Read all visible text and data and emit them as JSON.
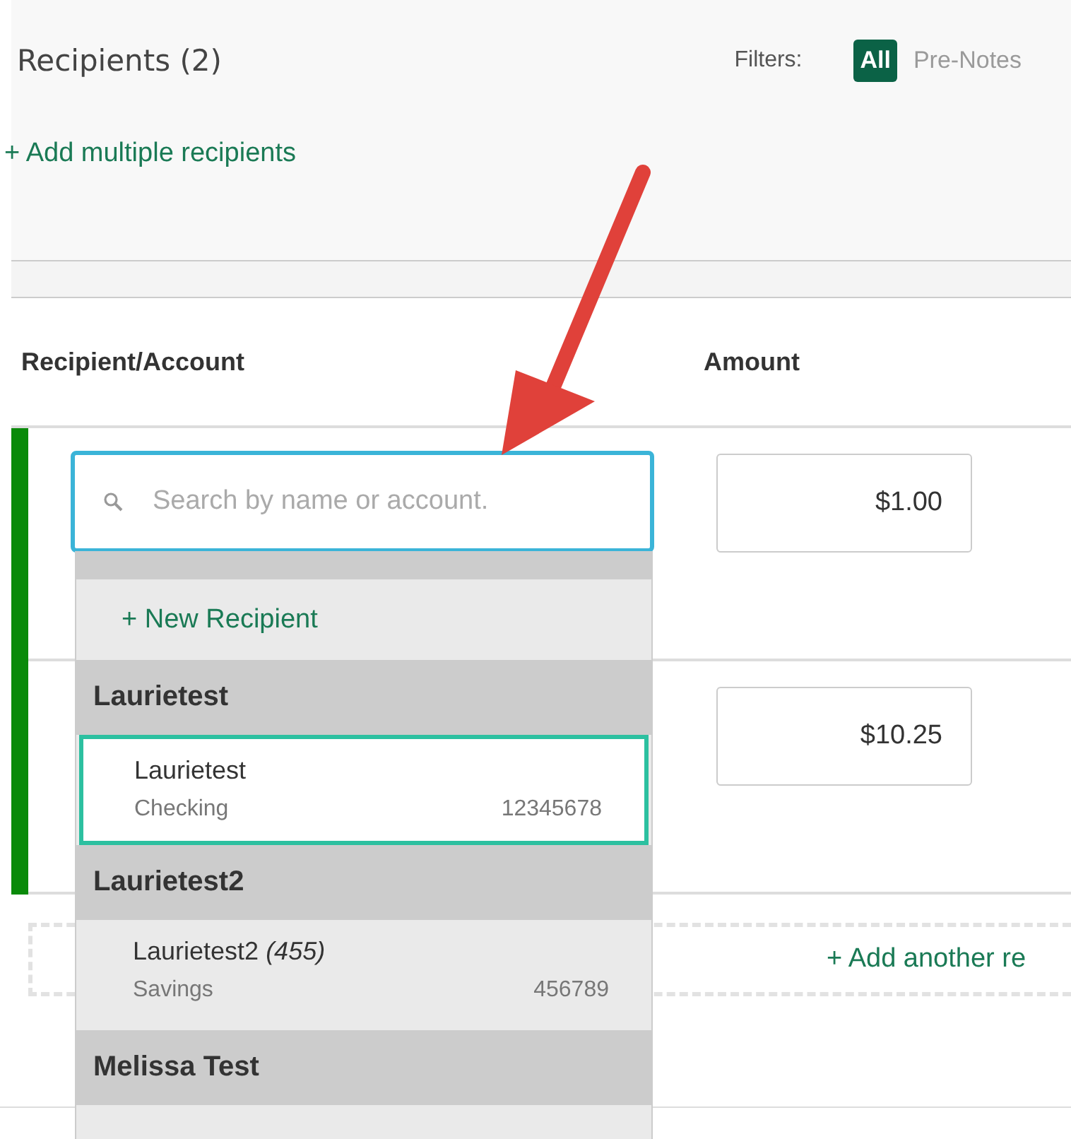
{
  "header": {
    "title": "Recipients (2)",
    "filters_label": "Filters:",
    "filters": [
      {
        "label": "All",
        "selected": true
      },
      {
        "label": "Pre-Notes",
        "selected": false
      }
    ],
    "add_multiple": "+ Add multiple recipients"
  },
  "columns": [
    "Recipient/Account",
    "Amount"
  ],
  "rows": [
    {
      "amount": "$1.00"
    },
    {
      "amount": "$10.25"
    }
  ],
  "search": {
    "placeholder": "Search by name or account."
  },
  "dropdown": {
    "new_recipient": "+ New Recipient",
    "groups": [
      {
        "name": "Laurietest",
        "accounts": [
          {
            "name": "Laurietest",
            "type": "Checking",
            "number": "12345678",
            "selected": true
          }
        ]
      },
      {
        "name": "Laurietest2",
        "accounts": [
          {
            "name": "Laurietest2 *(455)*",
            "type": "Savings",
            "number": "456789",
            "selected": false
          }
        ]
      },
      {
        "name": "Melissa Test"
      }
    ]
  },
  "add_another": "+ Add another re"
}
